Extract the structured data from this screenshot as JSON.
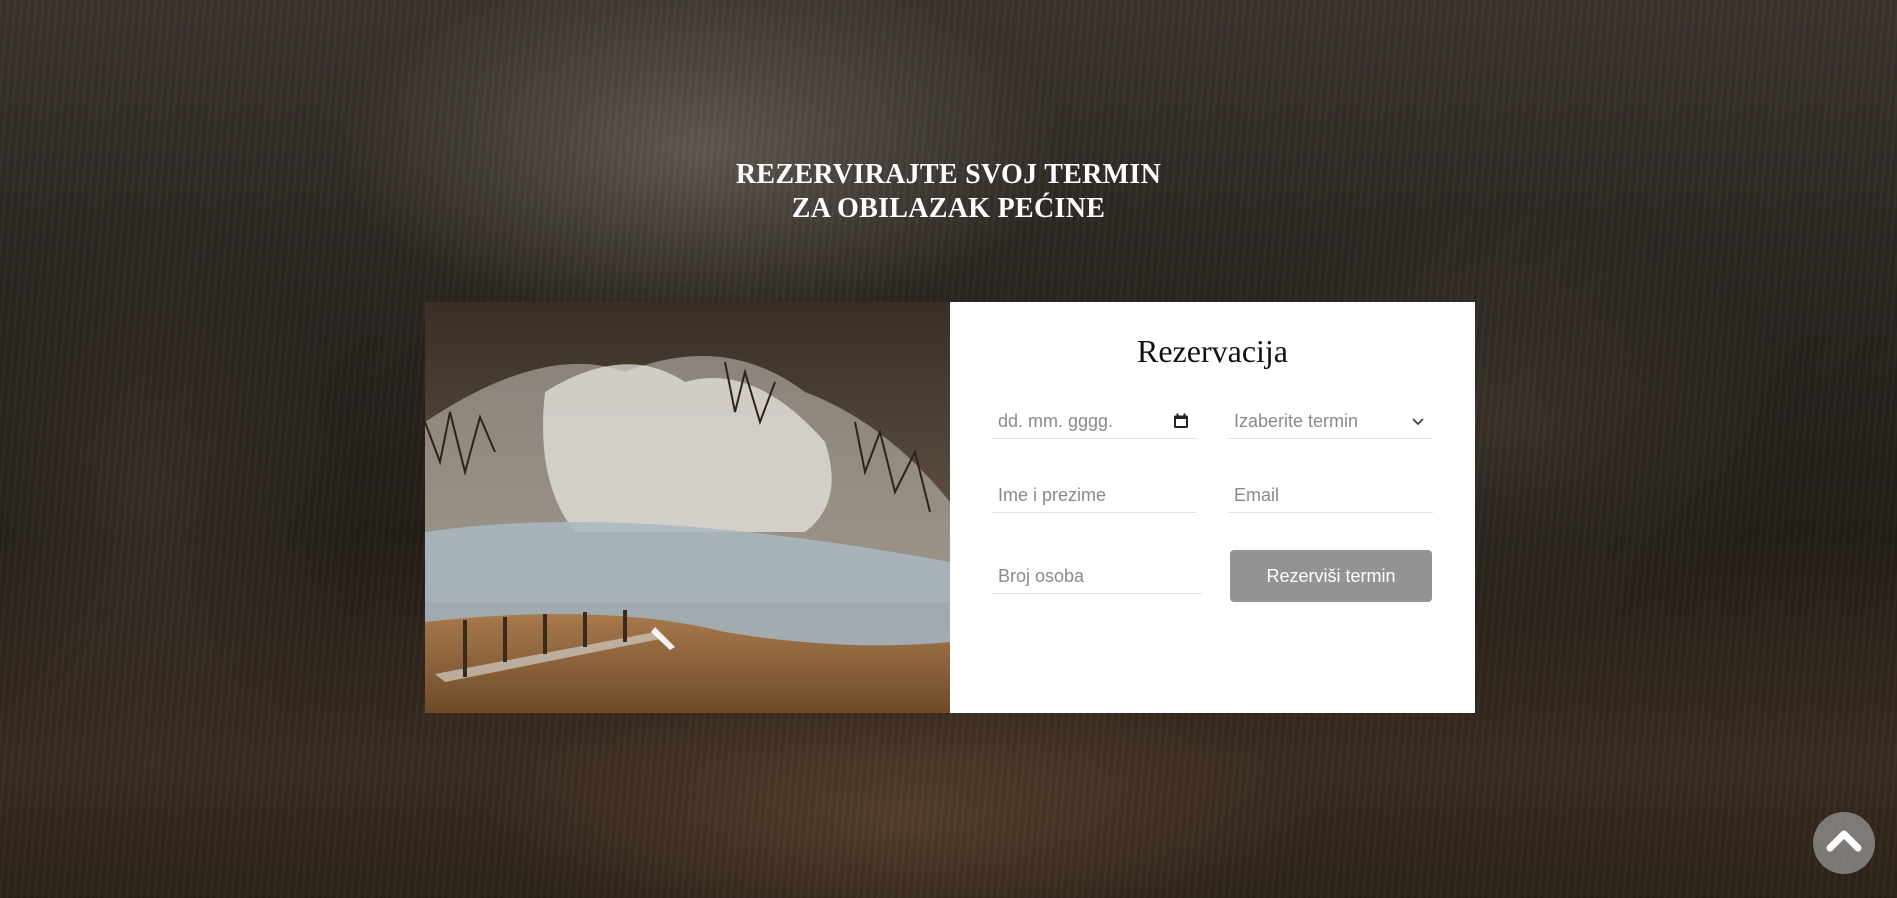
{
  "hero": {
    "heading_line1": "REZERVIRAJTE SVOJ TERMIN",
    "heading_line2": "ZA OBILAZAK PEĆINE"
  },
  "form": {
    "title": "Rezervacija",
    "date_placeholder": "dd. mm. gggg.",
    "term_select_value": "Izaberite termin",
    "name_placeholder": "Ime i prezime",
    "email_placeholder": "Email",
    "persons_placeholder": "Broj osoba",
    "submit_label": "Rezerviši termin"
  },
  "icons": {
    "calendar": "calendar-icon",
    "select_arrow": "chevron-down-icon",
    "scroll_top": "chevron-up-icon"
  },
  "colors": {
    "button_bg": "#939393",
    "panel_bg": "#ffffff",
    "heading_text": "#ffffff"
  }
}
